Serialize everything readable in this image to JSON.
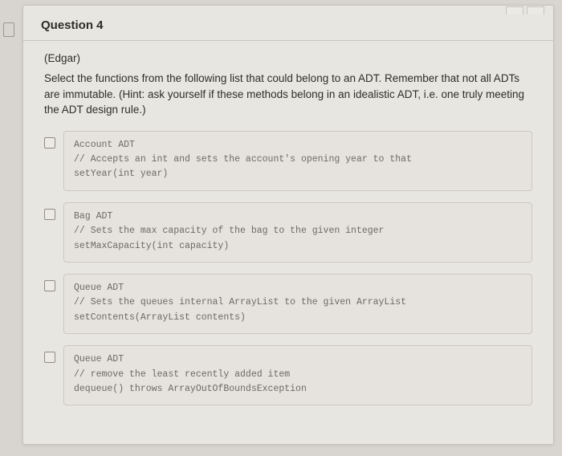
{
  "header": {
    "title": "Question 4"
  },
  "author": "(Edgar)",
  "prompt": "Select the functions from the following list that could belong to an ADT. Remember that not all ADTs are immutable. (Hint: ask yourself if these methods belong in an idealistic ADT, i.e. one truly meeting the ADT design rule.)",
  "options": [
    {
      "code": "Account ADT\n// Accepts an int and sets the account's opening year to that\nsetYear(int year)"
    },
    {
      "code": "Bag ADT\n// Sets the max capacity of the bag to the given integer\nsetMaxCapacity(int capacity)"
    },
    {
      "code": "Queue ADT\n// Sets the queues internal ArrayList to the given ArrayList\nsetContents(ArrayList contents)"
    },
    {
      "code": "Queue ADT\n// remove the least recently added item\ndequeue() throws ArrayOutOfBoundsException"
    }
  ]
}
